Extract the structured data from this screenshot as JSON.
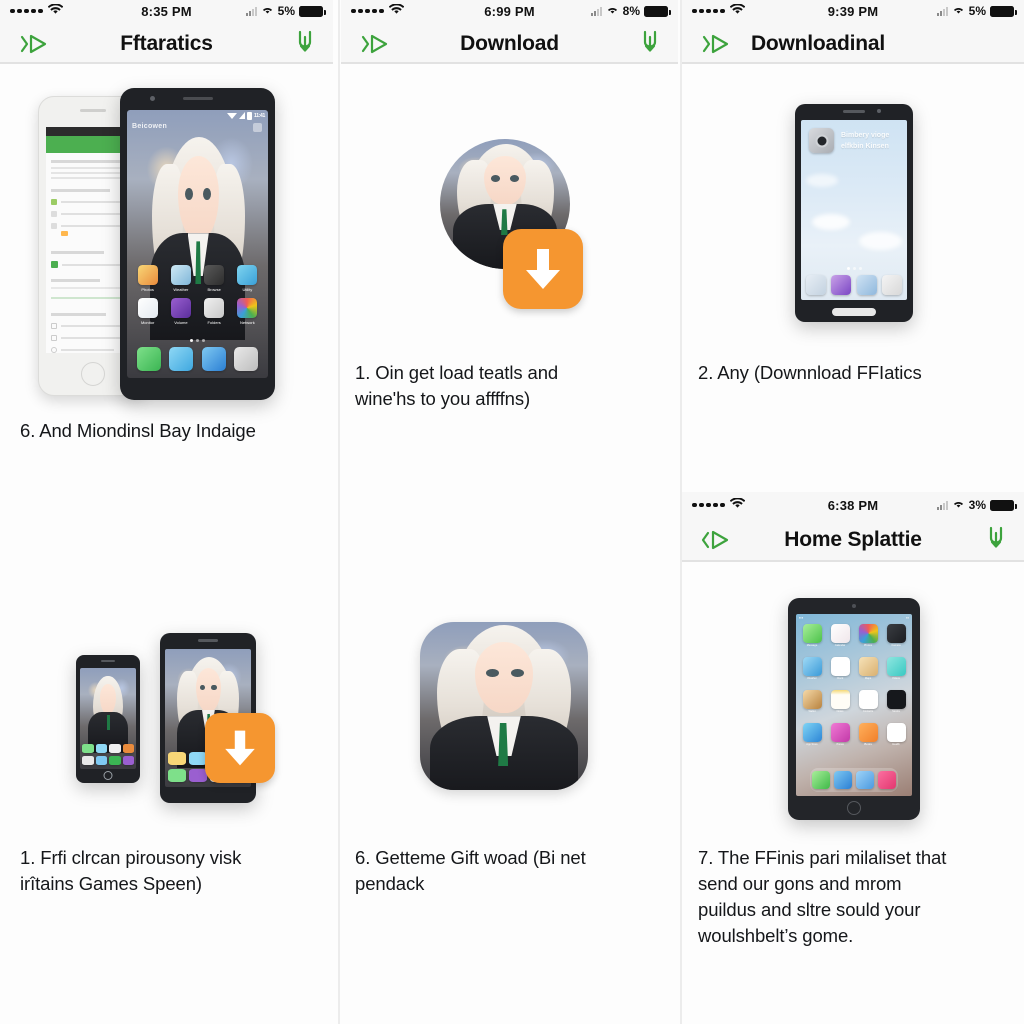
{
  "page": {
    "background_color": "#fdfdfd",
    "divider_color": "#ececec",
    "accent_green": "#3da33d",
    "accent_orange": "#f59630",
    "text_color": "#15171a",
    "columns": 3
  },
  "panels": [
    {
      "id": "panel-1",
      "header": {
        "statusbar": {
          "carrier_dots": 5,
          "wifi_icon": "wifi-icon",
          "time": "8:35 PM",
          "signal_icon": "cellular-signal-icon",
          "wifi_right_icon": "wifi-icon",
          "battery_percent": "5%",
          "battery_icon": "battery-icon"
        },
        "back_icon": "back-chevron-play-icon",
        "title": "Fftaratics",
        "download_icon": "download-tray-icon",
        "has_download_icon": true
      },
      "caption": "6.  And Miondinѕl Bay Indaige",
      "media": "two-phones-android-ios"
    },
    {
      "id": "panel-2",
      "header": {
        "statusbar": {
          "carrier_dots": 5,
          "wifi_icon": "wifi-icon",
          "time": "6:99 PM",
          "signal_icon": "cellular-signal-icon",
          "wifi_right_icon": "wifi-icon",
          "battery_percent": "8%",
          "battery_icon": "battery-icon"
        },
        "back_icon": "back-chevron-play-icon",
        "title": "Download",
        "download_icon": "download-tray-icon",
        "has_download_icon": true
      },
      "caption_line1": "1.  Oin get load teatls and",
      "caption_line2": "wine'hs to you affffns)",
      "media": "avatar-with-download-badge"
    },
    {
      "id": "panel-3",
      "header": {
        "statusbar": {
          "carrier_dots": 5,
          "wifi_icon": "wifi-icon",
          "time": "9:39 PM",
          "signal_icon": "cellular-signal-icon",
          "wifi_right_icon": "wifi-icon",
          "battery_percent": "5%",
          "battery_icon": "battery-icon"
        },
        "back_icon": "back-chevron-play-icon",
        "title": "Downloadinal",
        "download_icon": "download-tray-icon",
        "has_download_icon": false
      },
      "caption": "2.  Any (Downnload FFIatics",
      "media": "dark-phone-cloud-wallpaper",
      "phone_screen_text_line1": "Bimbery vioge",
      "phone_screen_text_line2": "elfkbin Kinsen"
    },
    {
      "id": "panel-4",
      "header": {
        "statusbar": {
          "carrier_dots": 5,
          "wifi_icon": "wifi-icon",
          "time": "6:38 PM",
          "signal_icon": "cellular-signal-icon",
          "wifi_right_icon": "wifi-icon",
          "battery_percent": "3%",
          "battery_icon": "battery-icon"
        },
        "back_icon": "back-chevron-play-icon",
        "title": "Home Splattie",
        "download_icon": "download-tray-icon",
        "has_download_icon": true
      },
      "caption_line1": "7. The FFinis pari milaliset that",
      "caption_line2": "send our gons and mrom",
      "caption_line3": "puildus and sltre sould your",
      "caption_line4": "woulshbelt’s gome.",
      "media": "tablet-ipad-home-screen"
    },
    {
      "id": "panel-5",
      "caption_line1": "1. Frfi clrcan  pirousony visk",
      "caption_line2": "irîtains Games Speen)",
      "media": "two-small-phones-with-download-badge"
    },
    {
      "id": "panel-6",
      "caption_line1": "6. Getteme Gift woad (Bi net",
      "caption_line2": "pendack",
      "media": "rounded-app-icon-avatar"
    }
  ]
}
